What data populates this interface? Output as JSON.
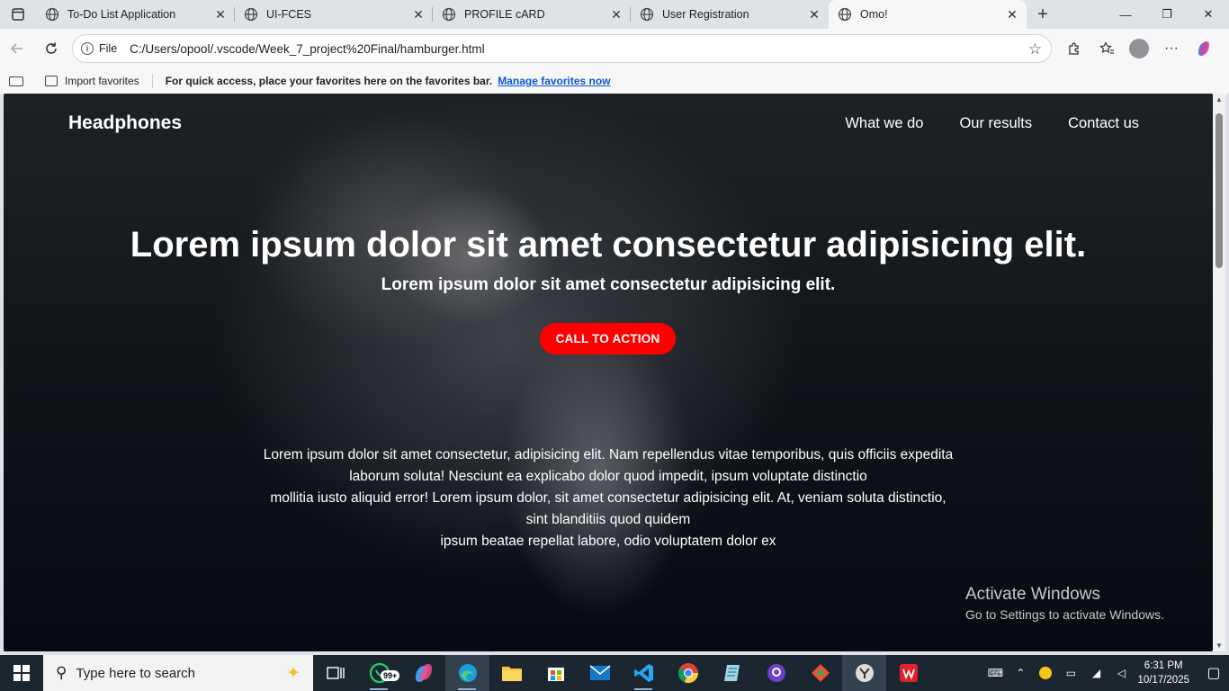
{
  "browser": {
    "tabs": [
      {
        "title": "To-Do List Application"
      },
      {
        "title": "UI-FCES"
      },
      {
        "title": "PROFILE cARD"
      },
      {
        "title": "User Registration"
      },
      {
        "title": "Omo!"
      }
    ],
    "address": {
      "scheme_label": "File",
      "url": "C:/Users/opool/.vscode/Week_7_project%20Final/hamburger.html"
    },
    "favorites_bar": {
      "import_label": "Import favorites",
      "message": "For quick access, place your favorites here on the favorites bar.",
      "manage_link": "Manage favorites now"
    }
  },
  "page": {
    "brand": "Headphones",
    "nav": [
      "What we do",
      "Our results",
      "Contact us"
    ],
    "hero_title": "Lorem ipsum dolor sit amet consectetur adipisicing elit.",
    "hero_subtitle": "Lorem ipsum dolor sit amet consectetur adipisicing elit.",
    "cta_label": "CALL TO ACTION",
    "paragraph_lines": [
      "Lorem ipsum dolor sit amet consectetur, adipisicing elit. Nam repellendus vitae temporibus, quis officiis expedita",
      "laborum soluta! Nesciunt ea explicabo dolor quod impedit, ipsum voluptate distinctio",
      "mollitia iusto aliquid error! Lorem ipsum dolor, sit amet consectetur adipisicing elit. At, veniam soluta distinctio,",
      "sint blanditiis quod quidem",
      "ipsum beatae repellat labore, odio voluptatem dolor ex"
    ],
    "accent_color": "#ff0000"
  },
  "watermark": {
    "line1": "Activate Windows",
    "line2": "Go to Settings to activate Windows."
  },
  "taskbar": {
    "search_placeholder": "Type here to search",
    "whatsapp_badge": "99+",
    "time": "6:31 PM",
    "date": "10/17/2025",
    "apps": [
      "task-view",
      "whatsapp",
      "copilot",
      "edge",
      "file-explorer",
      "microsoft-store",
      "mail",
      "vscode",
      "chrome",
      "notepad",
      "github-desktop",
      "git",
      "yarn",
      "wps-office"
    ]
  }
}
